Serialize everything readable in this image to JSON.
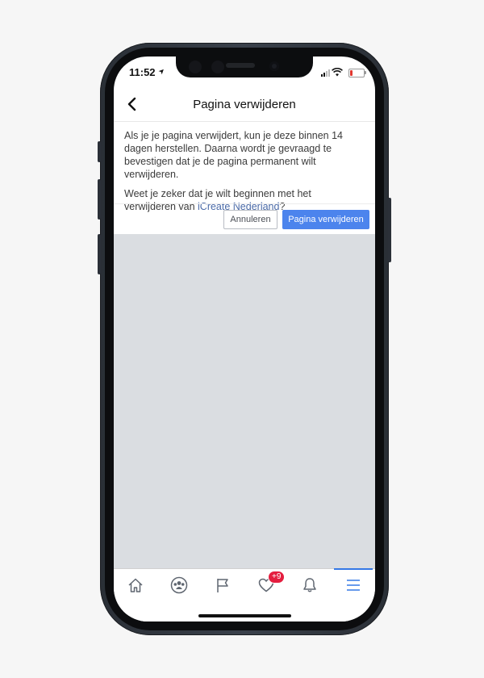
{
  "status_bar": {
    "time": "11:52",
    "location_glyph": "➤"
  },
  "nav": {
    "title": "Pagina verwijderen",
    "back_icon": "chevron-left-icon"
  },
  "body": {
    "paragraph1": "Als je je pagina verwijdert, kun je deze binnen 14 dagen herstellen. Daarna wordt je gevraagd te bevestigen dat je de pagina permanent wilt verwijderen.",
    "paragraph2_prefix": "Weet je zeker dat je wilt beginnen met het verwijderen van ",
    "page_name": "iCreate Nederland",
    "paragraph2_suffix": "?"
  },
  "actions": {
    "cancel_label": "Annuleren",
    "delete_label": "Pagina verwijderen"
  },
  "tabs": [
    {
      "icon": "home-icon"
    },
    {
      "icon": "groups-icon"
    },
    {
      "icon": "flag-icon"
    },
    {
      "icon": "heart-icon",
      "badge": "+9"
    },
    {
      "icon": "bell-icon"
    },
    {
      "icon": "menu-icon",
      "active": true
    }
  ],
  "colors": {
    "accent": "#3578e5",
    "primary_button": "#4c84ed",
    "badge": "#e41e3f",
    "link": "#4a6aa8"
  }
}
